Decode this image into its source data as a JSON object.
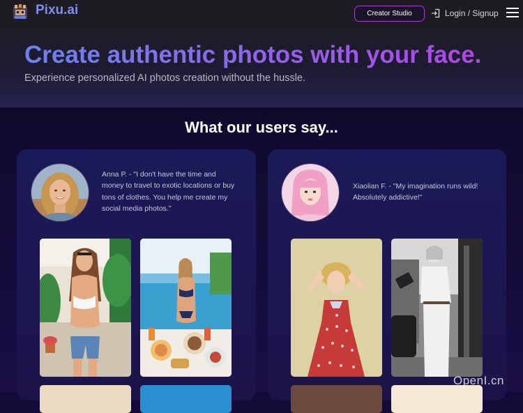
{
  "header": {
    "brand": "Pixu.ai",
    "creator_studio_label": "Creator Studio",
    "login_label": "Login / Signup",
    "icons": {
      "logo": "pixel-character-logo-icon",
      "login": "login-arrow-icon",
      "menu": "hamburger-menu-icon"
    }
  },
  "hero": {
    "headline": "Create authentic photos with your face.",
    "subhead": "Experience personalized AI photos creation without the hussle."
  },
  "testimonials": {
    "title": "What our users say...",
    "items": [
      {
        "quote": "Anna P. - \"I don't have the time and money to travel to exotic locations or buy tons of clothes. You help me create my social media photos.\"",
        "photos": [
          "garden-portrait",
          "pool-brunch-portrait"
        ]
      },
      {
        "quote": "Xiaolian F. - \"My imagination runs wild! Absolutely addictive!\"",
        "photos": [
          "vintage-polka-dress-portrait",
          "black-and-white-street-portrait"
        ]
      }
    ]
  },
  "watermark": "OpenI.cn",
  "colors": {
    "brand": "#7f8cf2",
    "accent_border": "#a43bd1",
    "headline_gradient_start": "#6c83f0",
    "headline_gradient_end": "#b245e6",
    "card_background": "#1b1a58"
  }
}
